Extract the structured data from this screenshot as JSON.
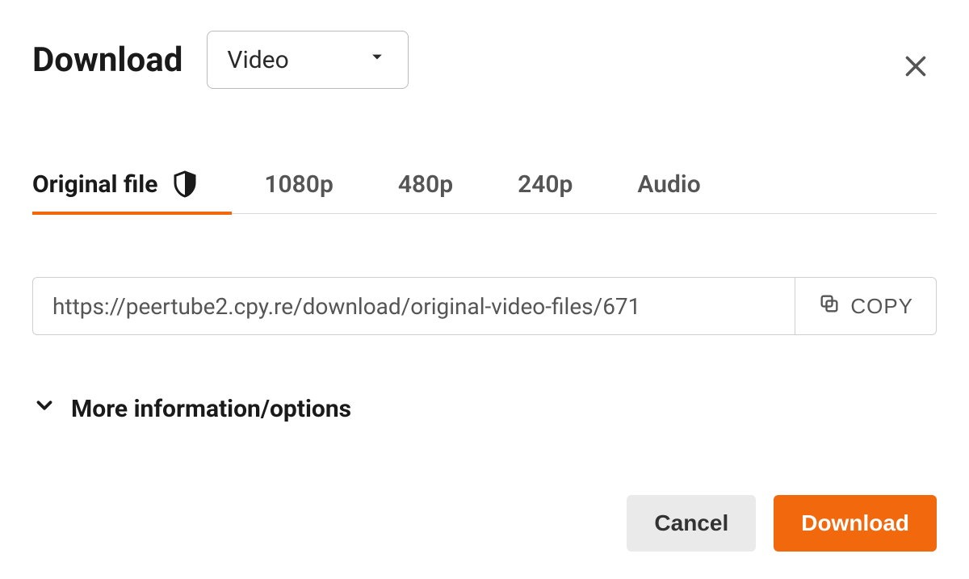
{
  "header": {
    "title": "Download",
    "dropdown_selected": "Video"
  },
  "tabs": [
    {
      "label": "Original file",
      "active": true,
      "icon": "shield"
    },
    {
      "label": "1080p",
      "active": false
    },
    {
      "label": "480p",
      "active": false
    },
    {
      "label": "240p",
      "active": false
    },
    {
      "label": "Audio",
      "active": false
    }
  ],
  "url_row": {
    "url": "https://peertube2.cpy.re/download/original-video-files/671",
    "copy_label": "COPY"
  },
  "more_section": {
    "label": "More information/options"
  },
  "footer": {
    "cancel_label": "Cancel",
    "download_label": "Download"
  },
  "colors": {
    "accent": "#f1680d"
  }
}
